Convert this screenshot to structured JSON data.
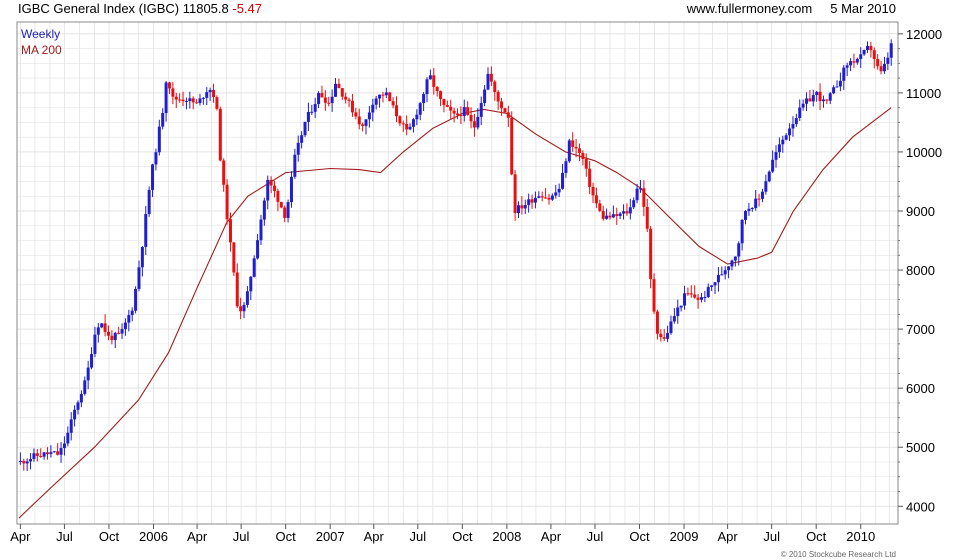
{
  "header": {
    "title": "IGBC General Index (IGBC) 11805.8",
    "change": "-5.47",
    "source": "www.fullermoney.com",
    "date": "5 Mar 2010"
  },
  "legend": {
    "weekly": "Weekly",
    "ma": "MA 200"
  },
  "footer": {
    "copyright": "© 2010 Stockcube Research Ltd"
  },
  "colors": {
    "up_bar": "#1f1fd0",
    "down_bar": "#e81010",
    "ma_line": "#a01c1c",
    "grid": "#e3e3e3",
    "frame": "#888888"
  },
  "chart_data": {
    "type": "ohlc",
    "frequency": "weekly",
    "xlim": [
      "2005-03-25",
      "2010-03-19"
    ],
    "ylim": [
      3700,
      12200
    ],
    "y_ticks": [
      4000,
      5000,
      6000,
      7000,
      8000,
      9000,
      10000,
      11000,
      12000
    ],
    "x_ticks": [
      {
        "label": "Apr",
        "date": "2005-04-01"
      },
      {
        "label": "Jul",
        "date": "2005-07-01"
      },
      {
        "label": "Oct",
        "date": "2005-10-01"
      },
      {
        "label": "2006",
        "date": "2006-01-01"
      },
      {
        "label": "Apr",
        "date": "2006-04-01"
      },
      {
        "label": "Jul",
        "date": "2006-07-01"
      },
      {
        "label": "Oct",
        "date": "2006-10-01"
      },
      {
        "label": "2007",
        "date": "2007-01-01"
      },
      {
        "label": "Apr",
        "date": "2007-04-01"
      },
      {
        "label": "Jul",
        "date": "2007-07-01"
      },
      {
        "label": "Oct",
        "date": "2007-10-01"
      },
      {
        "label": "2008",
        "date": "2008-01-01"
      },
      {
        "label": "Apr",
        "date": "2008-04-01"
      },
      {
        "label": "Jul",
        "date": "2008-07-01"
      },
      {
        "label": "Oct",
        "date": "2008-10-01"
      },
      {
        "label": "2009",
        "date": "2009-01-01"
      },
      {
        "label": "Apr",
        "date": "2009-04-01"
      },
      {
        "label": "Jul",
        "date": "2009-07-01"
      },
      {
        "label": "Oct",
        "date": "2009-10-01"
      },
      {
        "label": "2010",
        "date": "2010-01-01"
      }
    ],
    "grid": true,
    "price_path": [
      [
        "2005-04-01",
        4750
      ],
      [
        "2005-05-01",
        4850
      ],
      [
        "2005-06-01",
        4900
      ],
      [
        "2005-06-20",
        4880
      ],
      [
        "2005-07-05",
        5150
      ],
      [
        "2005-07-25",
        5700
      ],
      [
        "2005-08-15",
        6150
      ],
      [
        "2005-09-01",
        6900
      ],
      [
        "2005-09-12",
        7150
      ],
      [
        "2005-10-01",
        6850
      ],
      [
        "2005-10-25",
        6900
      ],
      [
        "2005-11-20",
        7400
      ],
      [
        "2005-12-10",
        8500
      ],
      [
        "2005-12-25",
        9500
      ],
      [
        "2006-01-20",
        10700
      ],
      [
        "2006-01-28",
        11300
      ],
      [
        "2006-02-10",
        10900
      ],
      [
        "2006-03-10",
        10900
      ],
      [
        "2006-04-01",
        10800
      ],
      [
        "2006-04-25",
        11100
      ],
      [
        "2006-05-10",
        10900
      ],
      [
        "2006-05-20",
        9800
      ],
      [
        "2006-06-05",
        8700
      ],
      [
        "2006-06-25",
        7300
      ],
      [
        "2006-07-10",
        7400
      ],
      [
        "2006-08-05",
        8600
      ],
      [
        "2006-08-25",
        9500
      ],
      [
        "2006-09-10",
        9300
      ],
      [
        "2006-10-01",
        8900
      ],
      [
        "2006-10-20",
        9900
      ],
      [
        "2006-11-10",
        10500
      ],
      [
        "2006-12-10",
        11000
      ],
      [
        "2007-01-01",
        10800
      ],
      [
        "2007-01-10",
        11200
      ],
      [
        "2007-02-10",
        10800
      ],
      [
        "2007-03-10",
        10400
      ],
      [
        "2007-04-01",
        10900
      ],
      [
        "2007-04-25",
        11000
      ],
      [
        "2007-05-20",
        10600
      ],
      [
        "2007-06-10",
        10300
      ],
      [
        "2007-07-05",
        10800
      ],
      [
        "2007-07-25",
        11300
      ],
      [
        "2007-08-20",
        10800
      ],
      [
        "2007-09-15",
        10600
      ],
      [
        "2007-10-05",
        10700
      ],
      [
        "2007-10-25",
        10400
      ],
      [
        "2007-11-10",
        10900
      ],
      [
        "2007-11-24",
        11350
      ],
      [
        "2007-12-10",
        10900
      ],
      [
        "2008-01-05",
        10600
      ],
      [
        "2008-01-15",
        9000
      ],
      [
        "2008-02-05",
        9100
      ],
      [
        "2008-03-10",
        9300
      ],
      [
        "2008-03-30",
        9200
      ],
      [
        "2008-04-20",
        9400
      ],
      [
        "2008-05-10",
        10200
      ],
      [
        "2008-06-05",
        9900
      ],
      [
        "2008-06-25",
        9300
      ],
      [
        "2008-07-15",
        8900
      ],
      [
        "2008-08-10",
        8900
      ],
      [
        "2008-09-10",
        9000
      ],
      [
        "2008-09-30",
        9500
      ],
      [
        "2008-10-15",
        8900
      ],
      [
        "2008-10-25",
        7700
      ],
      [
        "2008-11-05",
        7000
      ],
      [
        "2008-11-20",
        6800
      ],
      [
        "2008-12-10",
        7200
      ],
      [
        "2009-01-05",
        7600
      ],
      [
        "2009-02-05",
        7500
      ],
      [
        "2009-03-05",
        7800
      ],
      [
        "2009-03-25",
        8000
      ],
      [
        "2009-04-20",
        8300
      ],
      [
        "2009-05-05",
        9000
      ],
      [
        "2009-06-05",
        9200
      ],
      [
        "2009-07-05",
        9900
      ],
      [
        "2009-08-05",
        10400
      ],
      [
        "2009-09-05",
        10800
      ],
      [
        "2009-10-01",
        11000
      ],
      [
        "2009-10-20",
        10800
      ],
      [
        "2009-11-10",
        11100
      ],
      [
        "2009-12-05",
        11500
      ],
      [
        "2010-01-01",
        11600
      ],
      [
        "2010-01-20",
        11800
      ],
      [
        "2010-02-10",
        11300
      ],
      [
        "2010-02-22",
        11500
      ],
      [
        "2010-03-05",
        11806
      ]
    ],
    "ma200_path": [
      [
        "2005-03-29",
        3800
      ],
      [
        "2005-06-01",
        4300
      ],
      [
        "2005-09-01",
        5000
      ],
      [
        "2005-12-01",
        5800
      ],
      [
        "2006-02-01",
        6600
      ],
      [
        "2006-04-01",
        7700
      ],
      [
        "2006-06-01",
        8800
      ],
      [
        "2006-07-15",
        9250
      ],
      [
        "2006-10-01",
        9650
      ],
      [
        "2007-01-01",
        9720
      ],
      [
        "2007-03-01",
        9700
      ],
      [
        "2007-04-15",
        9650
      ],
      [
        "2007-06-01",
        10000
      ],
      [
        "2007-08-01",
        10400
      ],
      [
        "2007-10-01",
        10650
      ],
      [
        "2007-11-15",
        10720
      ],
      [
        "2008-01-01",
        10650
      ],
      [
        "2008-03-01",
        10300
      ],
      [
        "2008-05-01",
        10000
      ],
      [
        "2008-07-01",
        9850
      ],
      [
        "2008-08-15",
        9650
      ],
      [
        "2008-10-01",
        9400
      ],
      [
        "2008-12-01",
        8900
      ],
      [
        "2009-02-01",
        8400
      ],
      [
        "2009-04-01",
        8100
      ],
      [
        "2009-06-01",
        8200
      ],
      [
        "2009-07-01",
        8300
      ],
      [
        "2009-08-15",
        9000
      ],
      [
        "2009-10-15",
        9700
      ],
      [
        "2009-12-15",
        10250
      ],
      [
        "2010-03-05",
        10750
      ]
    ]
  }
}
